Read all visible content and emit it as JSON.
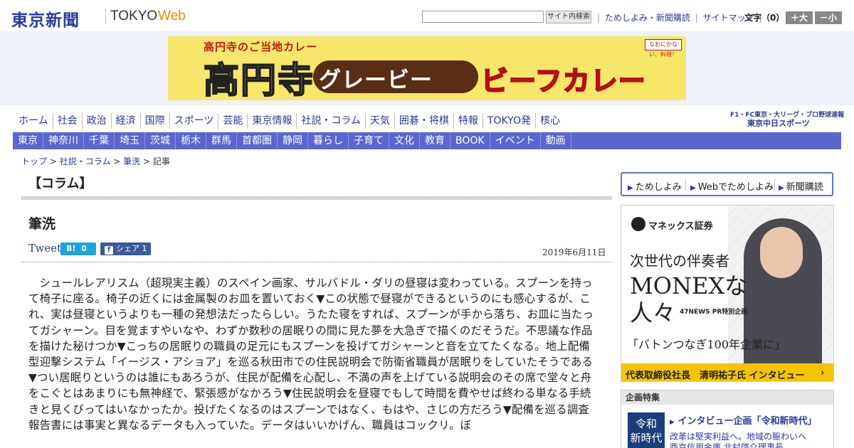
{
  "header": {
    "logo": "東京新聞",
    "logo_tokyo": "TOKYO",
    "logo_web": "Web",
    "search_placeholder": "",
    "search_button": "サイト内検索",
    "links": [
      "ためしよみ・新聞購読",
      "サイトマップ"
    ],
    "font_size_label": "文字（0）",
    "font_bigger": "＋大",
    "font_smaller": "－小"
  },
  "banner": {
    "sub": "高円寺のご当地カレー",
    "kouenji": "高円寺",
    "gravy": "グレービー",
    "beef": "ビーフカレー",
    "badge": "なおにかない、料理！"
  },
  "nav_primary": [
    "ホーム",
    "社会",
    "政治",
    "経済",
    "国際",
    "スポーツ",
    "芸能",
    "東京情報",
    "社説・コラム",
    "天気",
    "囲碁・将棋",
    "特報",
    "TOKYO発",
    "核心"
  ],
  "nav_secondary": [
    "東京",
    "神奈川",
    "千葉",
    "埼玉",
    "茨城",
    "栃木",
    "群馬",
    "首都圏",
    "静岡",
    "暮らし",
    "子育て",
    "文化",
    "教育",
    "BOOK",
    "イベント",
    "動画"
  ],
  "nav_right": {
    "line1": "F1・FC東京・大リーグ・プロ野球速報",
    "line2": "東京中日スポーツ"
  },
  "breadcrumb": {
    "items": [
      "トップ",
      "社説・コラム",
      "筆洗"
    ],
    "current": "記事",
    "separator": ">"
  },
  "article": {
    "section": "【コラム】",
    "title": "筆洗",
    "tweet": "Tweet",
    "hatena_label": "B!",
    "hatena_count": "0",
    "fb_label": "シェア",
    "fb_count": "1",
    "date": "2019年6月11日",
    "body": "シュールレアリスム（超現実主義）のスペイン画家、サルバドル・ダリの昼寝は変わっている。スプーンを持って椅子に座る。椅子の近くには金属製のお皿を置いておく▼この状態で昼寝ができるというのにも感心するが、これ、実は昼寝というよりも一種の発想法だったらしい。うたた寝をすれば、スプーンが手から落ち、お皿に当たってガシャーン。目を覚ますやいなや、わずか数秒の居眠りの間に見た夢を大急ぎで描くのだそうだ。不思議な作品を描けた秘けつか▼こっちの居眠りの職員の足元にもスプーンを投げてガシャーンと音を立てたくなる。地上配備型迎撃システム「イージス・アショア」を巡る秋田市での住民説明会で防衛省職員が居眠りをしていたそうである▼つい居眠りというのは誰にもあろうが、住民が配備を心配し、不満の声を上げている説明会のその席で堂々と舟をこぐとはあまりにも無神経で、緊張感がなかろう▼住民説明会を昼寝でもして時間を費やせば終わる単なる手続きと見くびってはいなかったか。投げたくなるのはスプーンではなく、もはや、さじの方だろう▼配備を巡る調査報告書には事実と異なるデータも入っていた。データはいいかげん、職員はコックリ。ぼ"
  },
  "sidebar": {
    "links": [
      "ためしよみ",
      "Webでためしよみ",
      "新聞購読"
    ],
    "ad": {
      "logo": "マネックス証券",
      "line1": "次世代の伴奏者",
      "line2": "MONEXな",
      "line3": "人々",
      "tag": "47NEWS PR特別企画",
      "line4": "「バトンつなぎ100年企業に」",
      "bar": "代表取締役社長　清明祐子氏 インタビュー",
      "bar_arrow": "›"
    },
    "feature": {
      "heading": "企画特集",
      "img_line1": "令和",
      "img_line2": "新時代",
      "title": "インタビュー企画「令和新時代」",
      "sub1": "改革は堅実利益へ。地域の賑わいへ",
      "sub2": "西京信用金庫 北村啓介理事長"
    }
  },
  "colors": {
    "brand_blue": "#2b3a9b",
    "nav_bar": "#5b66cf",
    "web_orange": "#e88a00"
  }
}
